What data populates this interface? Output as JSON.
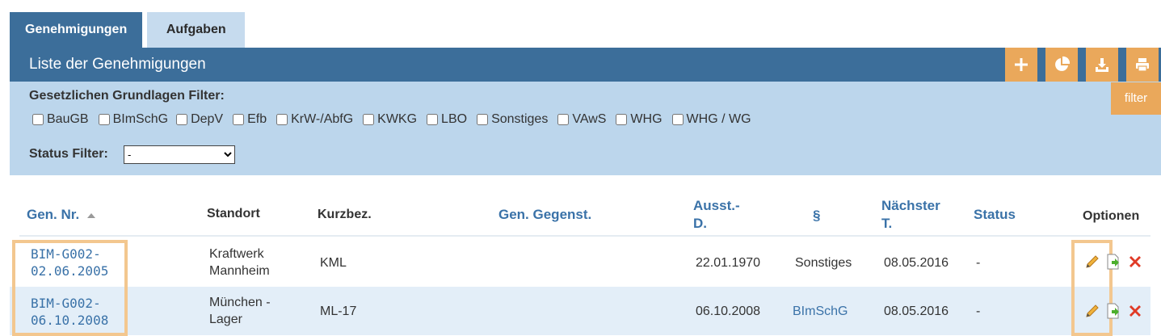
{
  "tabs": [
    {
      "label": "Genehmigungen",
      "active": true
    },
    {
      "label": "Aufgaben",
      "active": false
    }
  ],
  "header": {
    "title": "Liste der Genehmigungen",
    "buttons": [
      "plus-icon",
      "pie-chart-icon",
      "download-icon",
      "print-icon"
    ],
    "button_color": "#eaa85b"
  },
  "filters": {
    "legal_label": "Gesetzlichen Grundlagen Filter:",
    "options": [
      "BauGB",
      "BImSchG",
      "DepV",
      "Efb",
      "KrW-/AbfG",
      "KWKG",
      "LBO",
      "Sonstiges",
      "VAwS",
      "WHG",
      "WHG / WG"
    ],
    "status_label": "Status Filter:",
    "status_value": "-",
    "filter_button": "filter"
  },
  "table": {
    "headers": {
      "gen_nr": "Gen. Nr.",
      "standort": "Standort",
      "kurzbez": "Kurzbez.",
      "gegenst": "Gen. Gegenst.",
      "ausst_1": "Ausst.-",
      "ausst_2": "D.",
      "paragraph": "§",
      "naechster_1": "Nächster",
      "naechster_2": "T.",
      "status": "Status",
      "optionen": "Optionen"
    },
    "rows": [
      {
        "gen_nr_1": "BIM-G002-",
        "gen_nr_2": "02.06.2005",
        "standort_1": "Kraftwerk",
        "standort_2": "Mannheim",
        "kurzbez": "KML",
        "gegenst": "",
        "ausst": "22.01.1970",
        "paragraph": "Sonstiges",
        "naechster": "08.05.2016",
        "status": "-"
      },
      {
        "gen_nr_1": "BIM-G002-",
        "gen_nr_2": "06.10.2008",
        "standort_1": "München -",
        "standort_2": "Lager",
        "kurzbez": "ML-17",
        "gegenst": "",
        "ausst": "06.10.2008",
        "paragraph": "BImSchG",
        "naechster": "08.05.2016",
        "status": "-"
      }
    ]
  },
  "colors": {
    "primary": "#3c6e9a",
    "accent": "#eaa85b",
    "link": "#3a72a8",
    "filter_bg": "#bcd6ec",
    "highlight": "#f3c78f"
  }
}
